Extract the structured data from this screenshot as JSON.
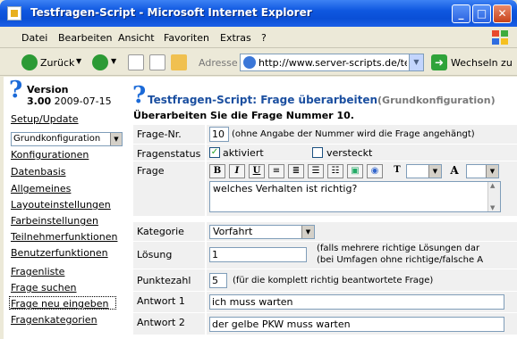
{
  "window": {
    "title": "Testfragen-Script - Microsoft Internet Explorer"
  },
  "menu": [
    "Datei",
    "Bearbeiten",
    "Ansicht",
    "Favoriten",
    "Extras",
    "?"
  ],
  "toolbar": {
    "back_label": "Zurück",
    "address_label": "Adresse",
    "address_value": "http://www.server-scripts.de/te",
    "go_label": "Wechseln zu"
  },
  "sidebar": {
    "version_label": "Version",
    "version_number": "3.00",
    "version_date": "2009-07-15",
    "setup_link": "Setup/Update",
    "config_select": "Grundkonfiguration",
    "links_group1": [
      "Konfigurationen",
      "Datenbasis",
      "Allgemeines",
      "Layouteinstellungen",
      "Farbeinstellungen",
      "Teilnehmerfunktionen",
      "Benutzerfunktionen"
    ],
    "links_group2": [
      "Fragenliste",
      "Frage suchen",
      "Frage neu eingeben",
      "Fragenkategorien"
    ]
  },
  "main": {
    "title": "Testfragen-Script: Frage überarbeiten",
    "title_sub": "(Grundkonfiguration)",
    "subtitle": "Überarbeiten Sie die Frage Nummer 10.",
    "form": {
      "nr_label": "Frage-Nr.",
      "nr_value": "10",
      "nr_hint": "(ohne Angabe der Nummer wird die Frage angehängt)",
      "status_label": "Fragenstatus",
      "status_active": "aktiviert",
      "status_hidden": "versteckt",
      "frage_label": "Frage",
      "frage_text": "welches Verhalten ist richtig?",
      "kategorie_label": "Kategorie",
      "kategorie_value": "Vorfahrt",
      "loesung_label": "Lösung",
      "loesung_value": "1",
      "loesung_hint1": "(falls mehrere richtige Lösungen dar",
      "loesung_hint2": "(bei Umfagen ohne richtige/falsche A",
      "punkte_label": "Punktezahl",
      "punkte_value": "5",
      "punkte_hint": "(für die komplett richtig beantwortete Frage)",
      "antwort1_label": "Antwort 1",
      "antwort1_value": "ich muss warten",
      "antwort2_label": "Antwort 2",
      "antwort2_value": "der gelbe PKW muss warten"
    }
  }
}
